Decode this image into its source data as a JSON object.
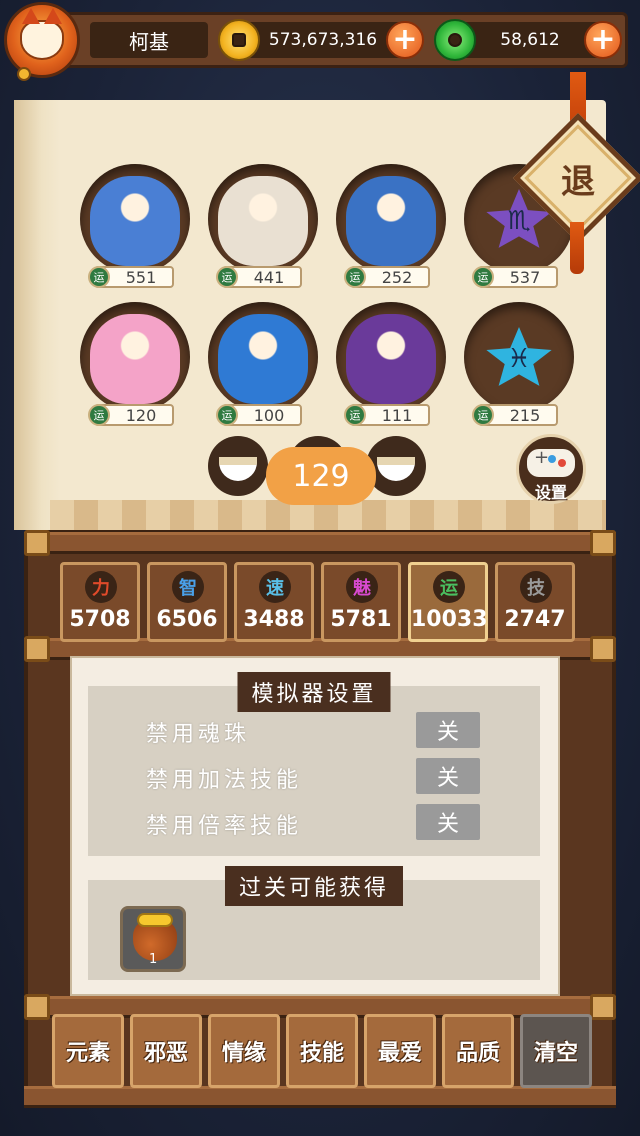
{
  "player": {
    "name": "柯基",
    "gold": "573,673,316",
    "jade": "58,612",
    "add_symbol": "+"
  },
  "exit_label": "退",
  "characters": [
    {
      "luck_tag": "运",
      "luck": "551",
      "color": "#4a7fd4"
    },
    {
      "luck_tag": "运",
      "luck": "441",
      "color": "#e9e0d2"
    },
    {
      "luck_tag": "运",
      "luck": "252",
      "color": "#3a72c4"
    },
    {
      "luck_tag": "运",
      "luck": "537",
      "symbol": "♏",
      "color": "#7c4fc0"
    },
    {
      "luck_tag": "运",
      "luck": "120",
      "color": "#f4a3c8"
    },
    {
      "luck_tag": "运",
      "luck": "100",
      "color": "#2f7ad4"
    },
    {
      "luck_tag": "运",
      "luck": "111",
      "color": "#6a3a9a"
    },
    {
      "luck_tag": "运",
      "luck": "215",
      "symbol": "♓",
      "color": "#2fb4e0"
    }
  ],
  "food_counter": "129",
  "settings_button_label": "设置",
  "stats": [
    {
      "icon": "力",
      "value": "5708",
      "color": "#e04a2a"
    },
    {
      "icon": "智",
      "value": "6506",
      "color": "#4aa0e8"
    },
    {
      "icon": "速",
      "value": "3488",
      "color": "#5ac0e8"
    },
    {
      "icon": "魅",
      "value": "5781",
      "color": "#d84ad0"
    },
    {
      "icon": "运",
      "value": "10033",
      "color": "#4ac060"
    },
    {
      "icon": "技",
      "value": "2747",
      "color": "#9a9a9a"
    }
  ],
  "simulator": {
    "title": "模拟器设置",
    "options": [
      {
        "label": "禁用魂珠",
        "state": "关"
      },
      {
        "label": "禁用加法技能",
        "state": "关"
      },
      {
        "label": "禁用倍率技能",
        "state": "关"
      }
    ]
  },
  "rewards": {
    "title": "过关可能获得",
    "items": [
      {
        "name": "gold-bag",
        "count": "1"
      }
    ]
  },
  "filters": [
    "元素",
    "邪恶",
    "情缘",
    "技能",
    "最爱",
    "品质"
  ],
  "clear_label": "清空"
}
